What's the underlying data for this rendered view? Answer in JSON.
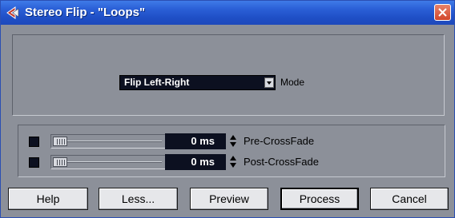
{
  "window": {
    "title": "Stereo Flip - \"Loops\""
  },
  "mode": {
    "selected": "Flip Left-Right",
    "label": "Mode"
  },
  "crossfades": [
    {
      "value": "0 ms",
      "label": "Pre-CrossFade"
    },
    {
      "value": "0 ms",
      "label": "Post-CrossFade"
    }
  ],
  "buttons": {
    "help": "Help",
    "less": "Less...",
    "preview": "Preview",
    "process": "Process",
    "cancel": "Cancel"
  }
}
